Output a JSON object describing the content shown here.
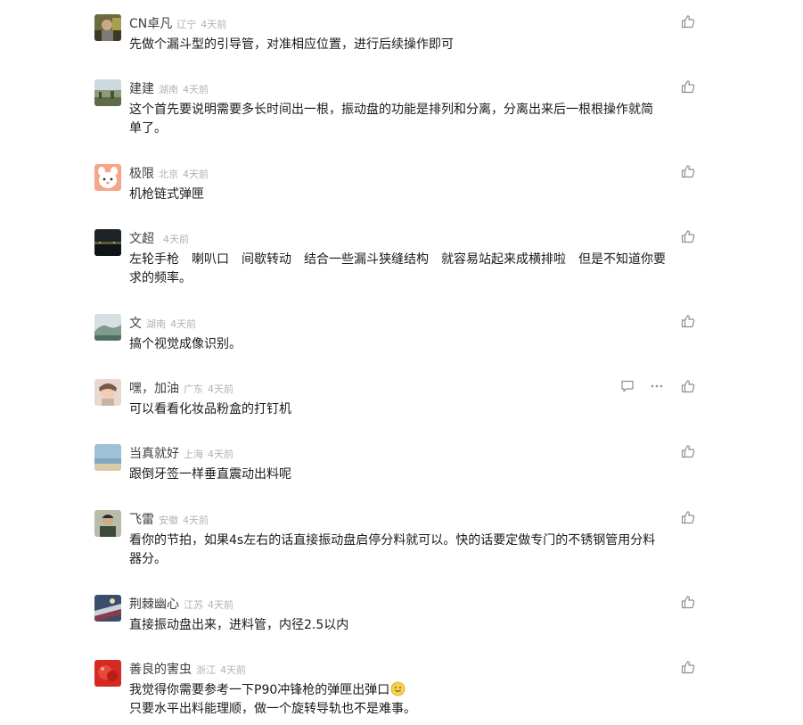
{
  "comments": [
    {
      "name": "CN卓凡",
      "location": "辽宁",
      "time": "4天前",
      "lines": [
        "先做个漏斗型的引导管，对准相应位置，进行后续操作即可"
      ]
    },
    {
      "name": "建建",
      "location": "湖南",
      "time": "4天前",
      "lines": [
        "这个首先要说明需要多长时间出一根，振动盘的功能是排列和分离，分离出来后一根根操作就简",
        "单了。"
      ]
    },
    {
      "name": "极限",
      "location": "北京",
      "time": "4天前",
      "lines": [
        "机枪链式弹匣"
      ]
    },
    {
      "name": "文超",
      "location": "",
      "time": "4天前",
      "lines": [
        "左轮手枪　喇叭口　间歇转动　结合一些漏斗狭缝结构　就容易站起来成横排啦　但是不知道你要",
        "求的频率。"
      ]
    },
    {
      "name": "文",
      "location": "湖南",
      "time": "4天前",
      "lines": [
        "搞个视觉成像识别。"
      ]
    },
    {
      "name": "嘿，加油",
      "location": "广东",
      "time": "4天前",
      "lines": [
        "可以看看化妆品粉盒的打钉机"
      ]
    },
    {
      "name": "当真就好",
      "location": "上海",
      "time": "4天前",
      "lines": [
        "跟倒牙签一样垂直震动出料呢"
      ]
    },
    {
      "name": "飞雷",
      "location": "安徽",
      "time": "4天前",
      "lines": [
        "看你的节拍，如果4s左右的话直接振动盘启停分料就可以。快的话要定做专门的不锈钢管用分料",
        "器分。"
      ]
    },
    {
      "name": "荆棘幽心",
      "location": "江苏",
      "time": "4天前",
      "lines": [
        "直接振动盘出来，进料管，内径2.5以内"
      ]
    },
    {
      "name": "善良的害虫",
      "location": "浙江",
      "time": "4天前",
      "lines": [
        "我觉得你需要参考一下P90冲锋枪的弹匣出弹口",
        "只要水平出料能理顺，做一个旋转导轨也不是难事。"
      ]
    }
  ],
  "icons": {
    "like": "thumbs-up-icon",
    "reply": "reply-icon",
    "more": "more-icon",
    "emoji": "smile-emoji"
  },
  "colors": {
    "name": "#404040",
    "meta": "#b2b2b2",
    "text": "#1a1a1a",
    "icon": "#8f8f8f"
  }
}
